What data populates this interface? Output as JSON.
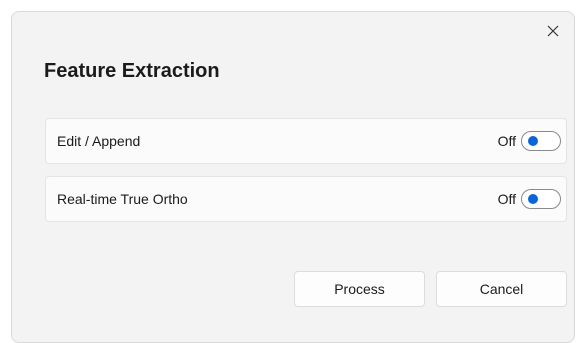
{
  "dialog": {
    "title": "Feature Extraction",
    "close_icon": "close-icon"
  },
  "settings": [
    {
      "label": "Edit / Append",
      "state": "Off",
      "enabled": false
    },
    {
      "label": "Real-time True Ortho",
      "state": "Off",
      "enabled": false
    }
  ],
  "buttons": {
    "process_label": "Process",
    "cancel_label": "Cancel"
  },
  "colors": {
    "dialog_background": "#f3f3f3",
    "toggle_accent": "#0a66d8"
  }
}
